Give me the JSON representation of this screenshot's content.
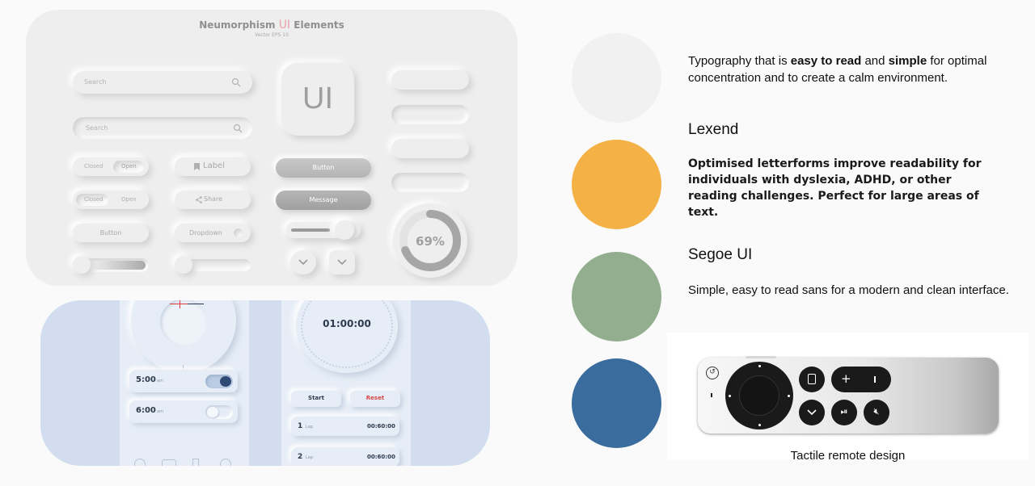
{
  "neumorphism": {
    "title_main": "Neumorphism",
    "title_ui": "UI",
    "title_rest": "Elements",
    "subtitle": "Vector EPS 10",
    "search1_placeholder": "Search",
    "search2_placeholder": "Search",
    "ui_tile": "UI",
    "toggle1": {
      "left": "Closed",
      "right": "Open"
    },
    "toggle2": {
      "left": "Closed",
      "right": "Open"
    },
    "label_button": "Label",
    "share_button": "Share",
    "button1": "Button",
    "dropdown": "Dropdown",
    "gray_button": "Button",
    "message_button": "Message",
    "progress_percent": "69%",
    "progress_value": 0.69
  },
  "clock": {
    "alarm1_time": "5:00",
    "alarm1_ampm": "am",
    "alarm1_on": true,
    "alarm2_time": "6:00",
    "alarm2_ampm": "am",
    "alarm2_on": false,
    "timer": "01:00:00",
    "start": "Start",
    "reset": "Reset",
    "laps": [
      {
        "num": "1",
        "label": "Lap",
        "time": "00:60:00"
      },
      {
        "num": "2",
        "label": "Lap",
        "time": "00:60:00"
      }
    ]
  },
  "swatches": {
    "light": "#f2f1f2",
    "orange": "#f4b145",
    "green": "#93ae8f",
    "blue": "#3a6d9e"
  },
  "typography": {
    "intro_1": "Typography that is ",
    "intro_bold_1": "easy to read",
    "intro_2": " and ",
    "intro_bold_2": "simple",
    "intro_3": " for optimal concentration and to create a calm environment.",
    "font1_name": "Lexend",
    "font1_desc": "Optimised letterforms improve readability for individuals with dyslexia, ADHD, or other reading challenges. Perfect for large areas of text.",
    "font2_name": "Segoe UI",
    "font2_desc": "Simple, easy to read sans for a modern and clean interface."
  },
  "remote": {
    "caption": "Tactile remote design"
  }
}
